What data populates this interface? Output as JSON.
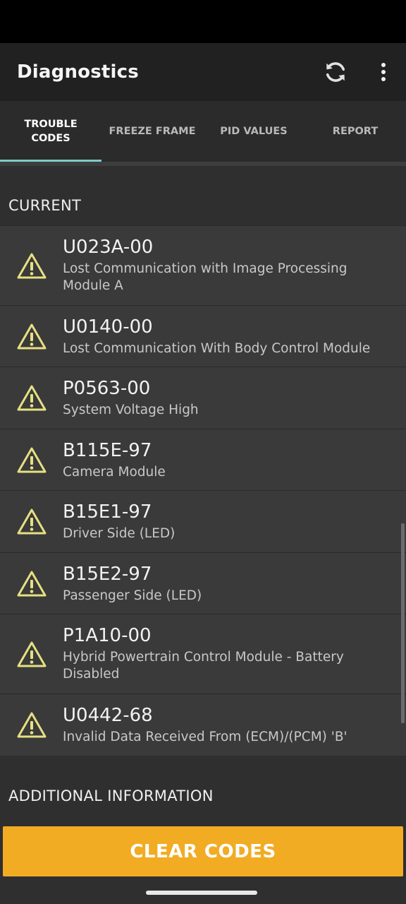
{
  "app": {
    "title": "Diagnostics"
  },
  "icons": {
    "refresh": "refresh-icon",
    "menu": "more-vert-icon",
    "warning": "warning-triangle-icon"
  },
  "tabs": [
    {
      "label": "TROUBLE CODES",
      "active": true
    },
    {
      "label": "FREEZE FRAME",
      "active": false
    },
    {
      "label": "PID VALUES",
      "active": false
    },
    {
      "label": "REPORT",
      "active": false
    }
  ],
  "sections": {
    "current": "CURRENT",
    "additional": "ADDITIONAL INFORMATION"
  },
  "codes": [
    {
      "code": "U023A-00",
      "description": "Lost Communication with Image Processing Module A"
    },
    {
      "code": "U0140-00",
      "description": "Lost Communication With Body Control Module"
    },
    {
      "code": "P0563-00",
      "description": "System Voltage High"
    },
    {
      "code": "B115E-97",
      "description": "Camera Module"
    },
    {
      "code": "B15E1-97",
      "description": "Driver Side (LED)"
    },
    {
      "code": "B15E2-97",
      "description": "Passenger Side (LED)"
    },
    {
      "code": "P1A10-00",
      "description": "Hybrid Powertrain Control Module - Battery Disabled"
    },
    {
      "code": "U0442-68",
      "description": "Invalid Data Received From (ECM)/(PCM) 'B'"
    }
  ],
  "actions": {
    "clear_codes": "CLEAR CODES"
  },
  "colors": {
    "accent": "#f1ac24",
    "tab_indicator": "#7fc9c6",
    "warning": "#e6e082"
  }
}
